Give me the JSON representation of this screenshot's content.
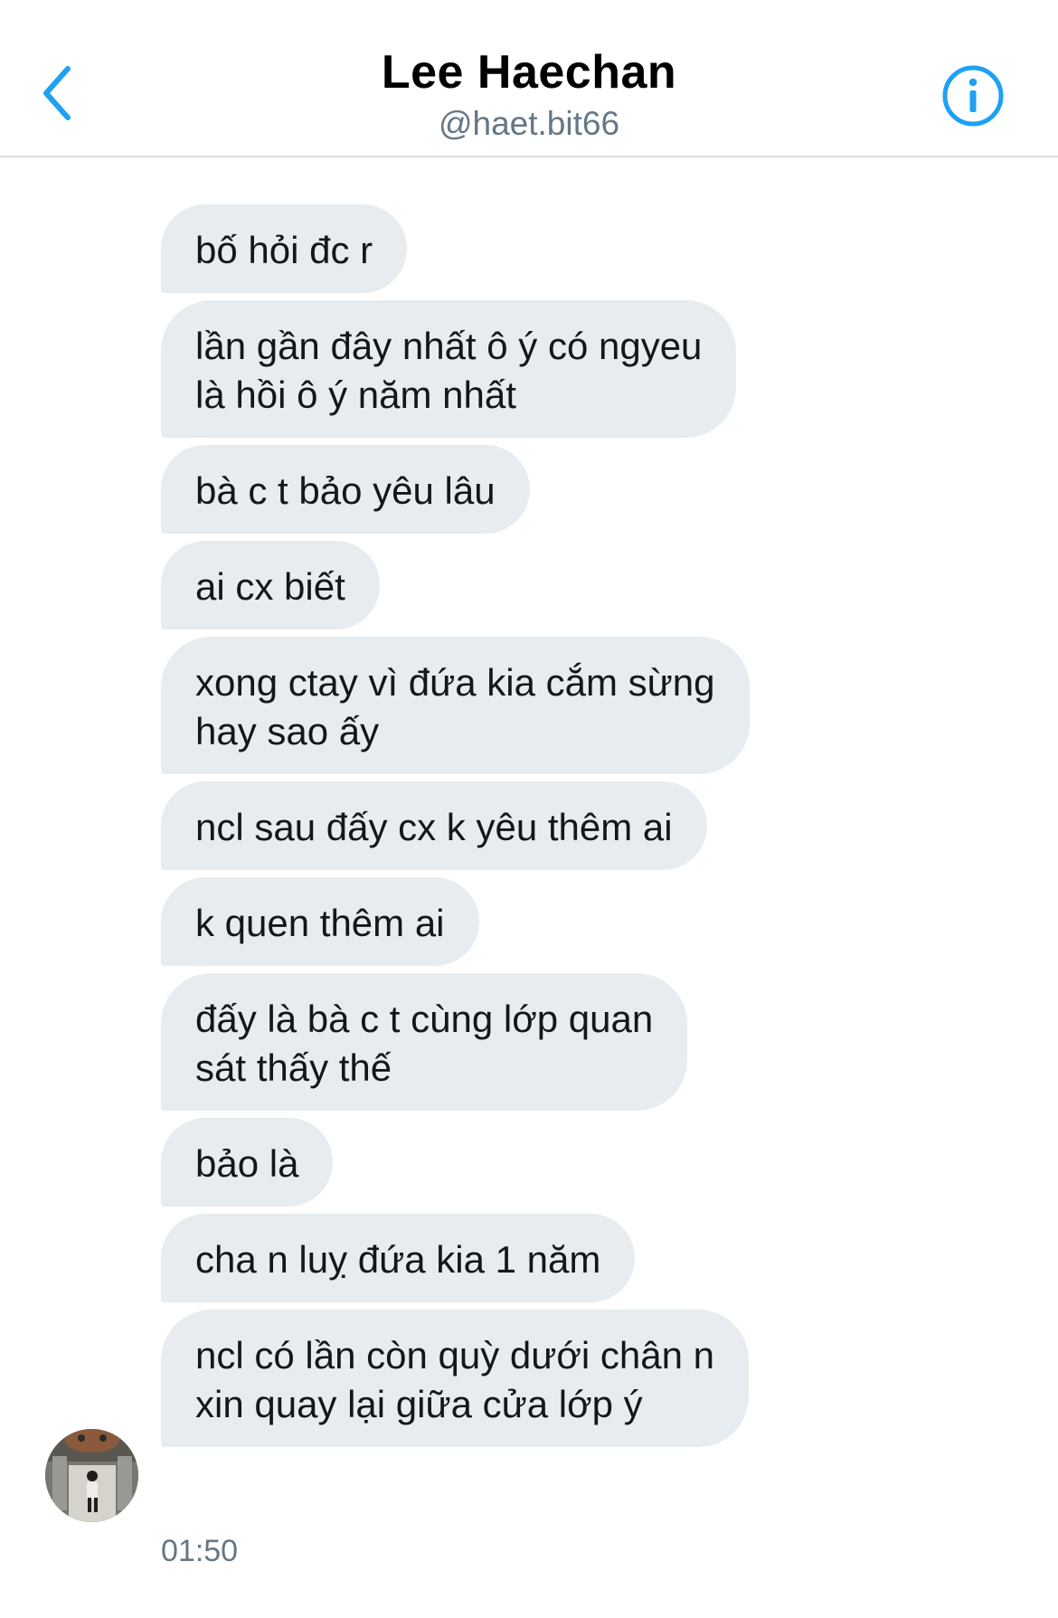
{
  "header": {
    "name": "Lee Haechan",
    "handle": "@haet.bit66",
    "back_icon": "chevron-left-icon",
    "info_icon": "info-circle-icon",
    "accent_color": "#1da1f2"
  },
  "conversation": {
    "messages": [
      {
        "text": "bố hỏi đc r"
      },
      {
        "text": "lần gần đây nhất ô ý có ngyeu\nlà hồi ô ý năm nhất"
      },
      {
        "text": "bà c t bảo yêu lâu"
      },
      {
        "text": "ai cx biết"
      },
      {
        "text": "xong ctay vì đứa kia cắm sừng\nhay sao ấy"
      },
      {
        "text": "ncl sau đấy cx k yêu thêm ai"
      },
      {
        "text": "k quen thêm ai"
      },
      {
        "text": "đấy là bà c t cùng lớp quan\nsát thấy thế"
      },
      {
        "text": "bảo là"
      },
      {
        "text": "cha n luỵ đứa kia 1 năm"
      },
      {
        "text": "ncl có lần còn quỳ dưới chân n\nxin quay lại giữa cửa lớp ý"
      }
    ],
    "timestamp": "01:50",
    "bubble_color": "#e6ecf0",
    "text_color": "#14171a"
  }
}
